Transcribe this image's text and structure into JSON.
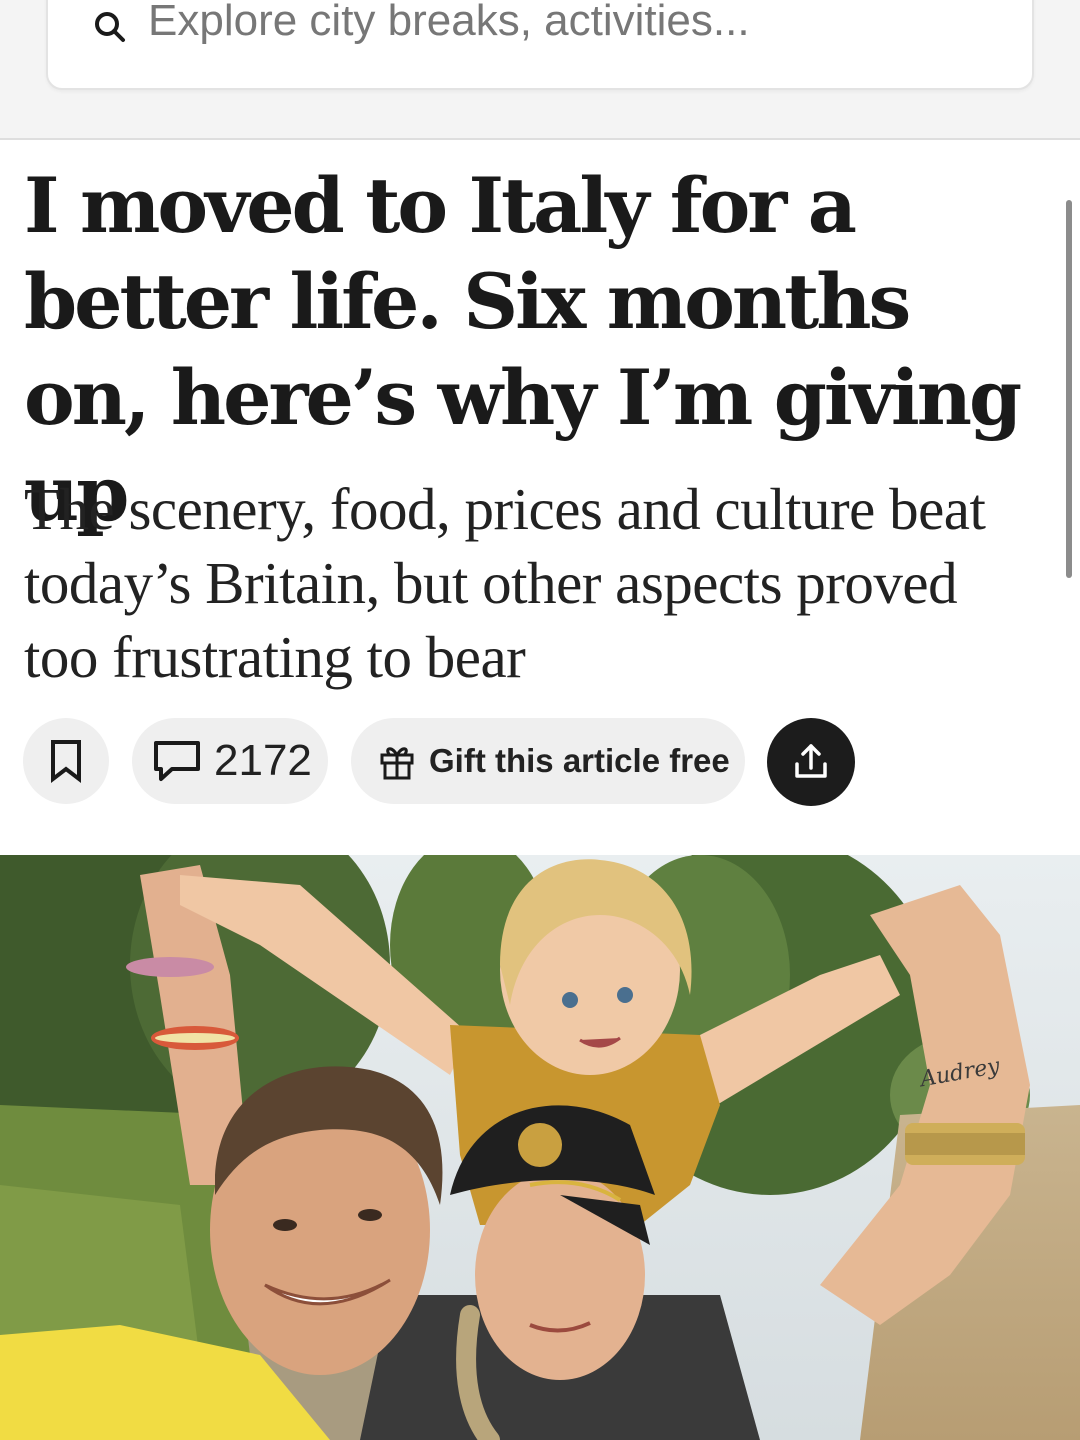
{
  "search": {
    "placeholder": "Explore city breaks, activities..."
  },
  "article": {
    "headline": "I moved to Italy for a better life. Six months on, here’s why I’m giving up",
    "standfirst": "The scenery, food, prices and culture beat today’s Britain, but other aspects proved too frustrating to bear"
  },
  "actions": {
    "comments_count": "2172",
    "gift_label": "Gift this article free"
  },
  "hero": {
    "tattoo_text": "Audrey"
  },
  "colors": {
    "share_button_bg": "#1c1c1c",
    "pill_bg": "#efefef",
    "search_area_bg": "#f4f4f4"
  },
  "icons": [
    "search-icon",
    "bookmark-icon",
    "comment-icon",
    "gift-icon",
    "share-icon"
  ]
}
